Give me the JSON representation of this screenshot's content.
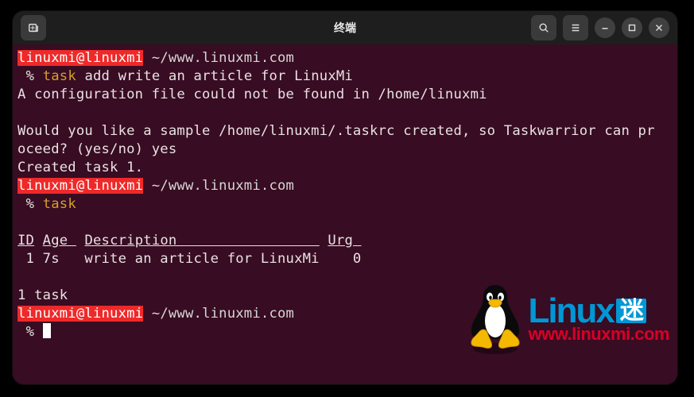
{
  "titlebar": {
    "title": "终端"
  },
  "prompt": {
    "user_host": "linuxmi@linuxmi",
    "cwd": "~/www.linuxmi.com",
    "symbol": "%"
  },
  "commands": {
    "c1_cmd": "task",
    "c1_args": " add write an article for LinuxMi",
    "c2_cmd": "task"
  },
  "output": {
    "err": "A configuration file could not be found in /home/linuxmi",
    "q1": "Would you like a sample /home/linuxmi/.taskrc created, so Taskwarrior can pr",
    "q2": "oceed? (yes/no) yes",
    "created": "Created task 1.",
    "hdr_id": "ID",
    "hdr_age": "Age ",
    "hdr_desc": "Description                 ",
    "hdr_urg": "Urg ",
    "row": " 1 7s   write an article for LinuxMi    0",
    "tally": "1 task"
  },
  "watermark": {
    "brand": "Linux",
    "suffix": "迷",
    "url": "www.linuxmi.com"
  }
}
